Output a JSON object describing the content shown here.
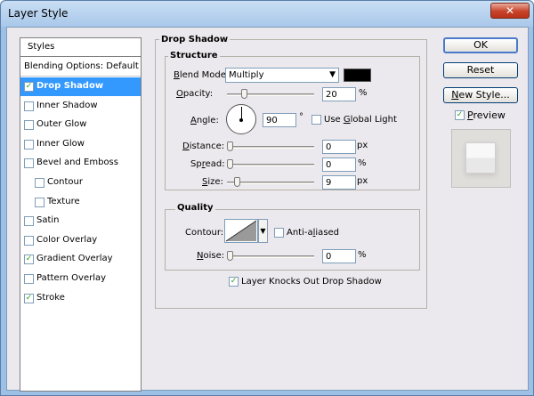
{
  "window": {
    "title": "Layer Style",
    "close_glyph": "✕"
  },
  "styles_list": {
    "header": "Styles",
    "blending": "Blending Options: Default",
    "items": [
      {
        "label": "Drop Shadow",
        "checked": true,
        "selected": true
      },
      {
        "label": "Inner Shadow",
        "checked": false
      },
      {
        "label": "Outer Glow",
        "checked": false
      },
      {
        "label": "Inner Glow",
        "checked": false
      },
      {
        "label": "Bevel and Emboss",
        "checked": false
      },
      {
        "label": "Contour",
        "checked": false,
        "sub": true
      },
      {
        "label": "Texture",
        "checked": false,
        "sub": true
      },
      {
        "label": "Satin",
        "checked": false
      },
      {
        "label": "Color Overlay",
        "checked": false
      },
      {
        "label": "Gradient Overlay",
        "checked": true
      },
      {
        "label": "Pattern Overlay",
        "checked": false
      },
      {
        "label": "Stroke",
        "checked": true
      }
    ]
  },
  "drop_shadow": {
    "title": "Drop Shadow",
    "structure": {
      "title": "Structure",
      "blend_mode_label_1": "B",
      "blend_mode_label_2": "lend Mode:",
      "blend_mode_value": "Multiply",
      "blend_color": "#000000",
      "opacity_label_1": "O",
      "opacity_label_2": "pacity:",
      "opacity_value": "20",
      "opacity_unit": "%",
      "angle_label_1": "A",
      "angle_label_2": "ngle:",
      "angle_value": "90",
      "angle_unit": "°",
      "global_light_label_1": "Use ",
      "global_light_label_2": "G",
      "global_light_label_3": "lobal Light",
      "global_light_checked": false,
      "distance_label_1": "D",
      "distance_label_2": "istance:",
      "distance_value": "0",
      "distance_unit": "px",
      "spread_label_1": "Sp",
      "spread_label_2": "r",
      "spread_label_3": "ead:",
      "spread_value": "0",
      "spread_unit": "%",
      "size_label_1": "S",
      "size_label_2": "ize:",
      "size_value": "9",
      "size_unit": "px"
    },
    "quality": {
      "title": "Quality",
      "contour_label": "Contour:",
      "anti_aliased_label_1": "Anti-a",
      "anti_aliased_label_2": "l",
      "anti_aliased_label_3": "iased",
      "anti_aliased_checked": false,
      "noise_label_1": "N",
      "noise_label_2": "oise:",
      "noise_value": "0",
      "noise_unit": "%"
    },
    "knockout_label": "Layer Knocks Out Drop Shadow",
    "knockout_checked": true
  },
  "buttons": {
    "ok": "OK",
    "reset": "Reset",
    "new_style_1": "N",
    "new_style_2": "ew Style...",
    "preview_label_1": "P",
    "preview_label_2": "review",
    "preview_checked": true
  },
  "icons": {
    "checkmark": "✓",
    "dropdown_arrow": "▼"
  },
  "colors": {
    "selected_bg": "#3399ff",
    "check_green": "#21a121"
  }
}
